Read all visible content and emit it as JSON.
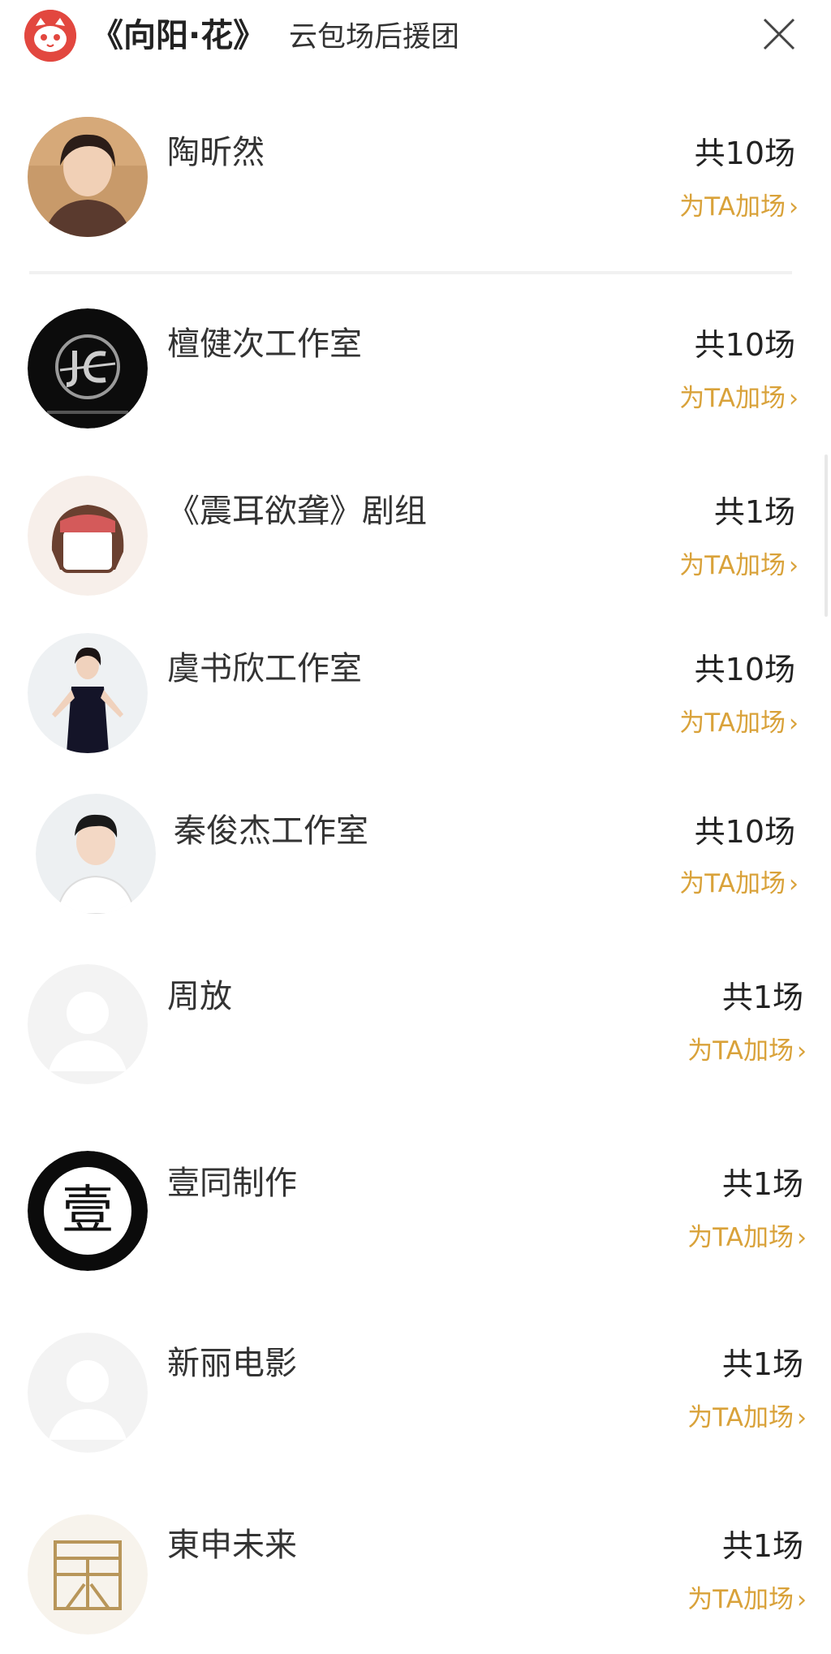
{
  "header": {
    "title": "《向阳·花》",
    "subtitle": "云包场后援团",
    "close_icon": "close-icon",
    "logo_icon": "cat-logo-icon"
  },
  "colors": {
    "accent": "#d9a23a",
    "logo_red": "#e2473f",
    "divider": "#f1f1f1"
  },
  "supporters": [
    {
      "name": "陶昕然",
      "count": "共10场",
      "action": "为TA加场",
      "avatar": "actress-photo"
    },
    {
      "name": "檀健次工作室",
      "count": "共10场",
      "action": "为TA加场",
      "avatar": "studio-logo-black"
    },
    {
      "name": "《震耳欲聋》剧组",
      "count": "共1场",
      "action": "为TA加场",
      "avatar": "cartoon-character"
    },
    {
      "name": "虞书欣工作室",
      "count": "共10场",
      "action": "为TA加场",
      "avatar": "actress-photo"
    },
    {
      "name": "秦俊杰工作室",
      "count": "共10场",
      "action": "为TA加场",
      "avatar": "actor-photo"
    },
    {
      "name": "周放",
      "count": "共1场",
      "action": "为TA加场",
      "avatar": "default-avatar"
    },
    {
      "name": "壹同制作",
      "count": "共1场",
      "action": "为TA加场",
      "avatar": "yi-logo"
    },
    {
      "name": "新丽电影",
      "count": "共1场",
      "action": "为TA加场",
      "avatar": "default-avatar"
    },
    {
      "name": "東申未来",
      "count": "共1场",
      "action": "为TA加场",
      "avatar": "dongshen-logo"
    }
  ],
  "yi_logo_char": "壹"
}
